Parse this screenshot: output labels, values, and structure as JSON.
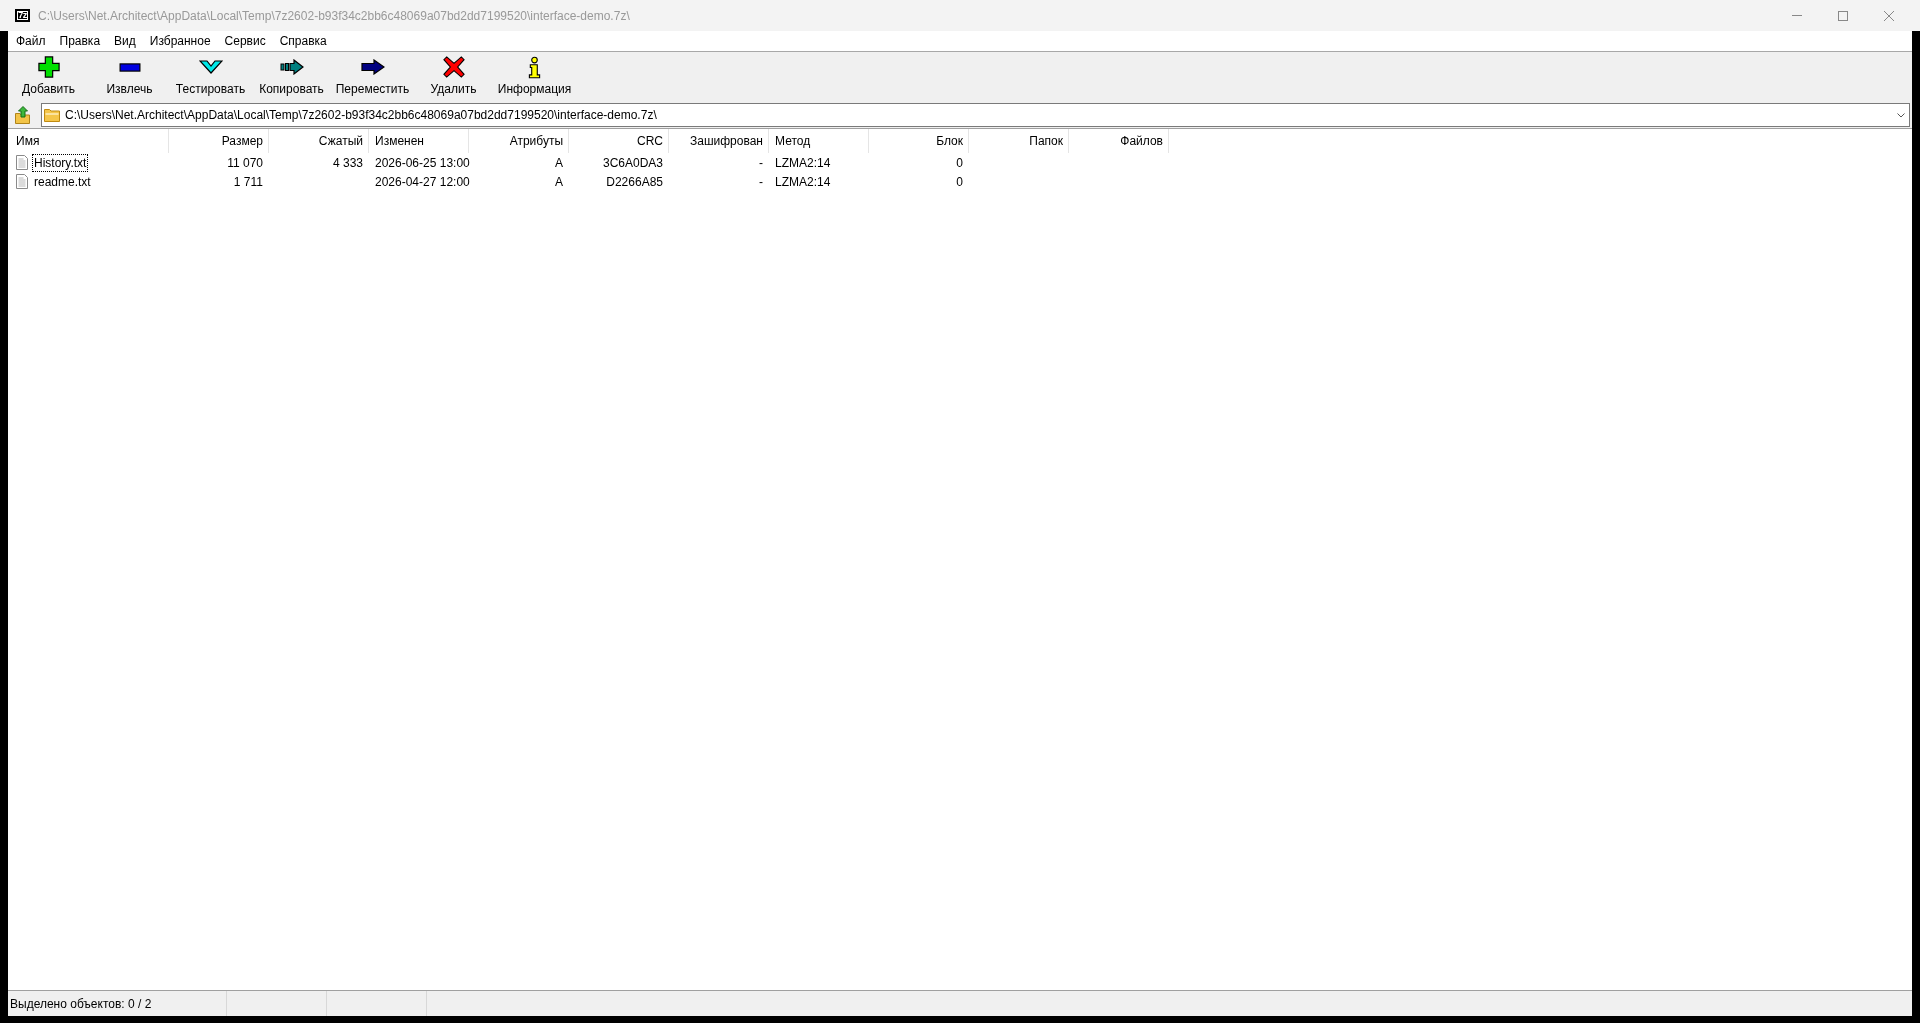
{
  "window": {
    "logo": "7z",
    "title": "C:\\Users\\Net.Architect\\AppData\\Local\\Temp\\7z2602-b93f34c2bb6c48069a07bd2dd7199520\\interface-demo.7z\\"
  },
  "menu": [
    "Файл",
    "Правка",
    "Вид",
    "Избранное",
    "Сервис",
    "Справка"
  ],
  "toolbar": [
    {
      "kind": "add",
      "label": "Добавить"
    },
    {
      "kind": "extract",
      "label": "Извлечь"
    },
    {
      "kind": "test",
      "label": "Тестировать"
    },
    {
      "kind": "copy",
      "label": "Копировать"
    },
    {
      "kind": "move",
      "label": "Переместить"
    },
    {
      "kind": "delete",
      "label": "Удалить"
    },
    {
      "kind": "info",
      "label": "Информация"
    }
  ],
  "address": {
    "path": "C:\\Users\\Net.Architect\\AppData\\Local\\Temp\\7z2602-b93f34c2bb6c48069a07bd2dd7199520\\interface-demo.7z\\"
  },
  "table": {
    "columns": [
      "Имя",
      "Размер",
      "Сжатый",
      "Изменен",
      "Атрибуты",
      "CRC",
      "Зашифрован",
      "Метод",
      "Блок",
      "Папок",
      "Файлов"
    ],
    "rows": [
      {
        "name": "History.txt",
        "size": "11 070",
        "packed_size": "4 333",
        "modified": "2026-06-25 13:00",
        "attributes": "A",
        "crc": "3C6A0DA3",
        "encrypted": "-",
        "method": "LZMA2:14",
        "block": "0",
        "selected": false,
        "focused": true
      },
      {
        "name": "readme.txt",
        "size": "1 711",
        "modified": "2026-04-27 12:00",
        "attributes": "A",
        "crc": "D2266A85",
        "encrypted": "-",
        "method": "LZMA2:14",
        "block": "0",
        "selected": false,
        "focused": false
      }
    ]
  },
  "status_bar": {
    "selection": "Выделено объектов: 0 / 2"
  }
}
